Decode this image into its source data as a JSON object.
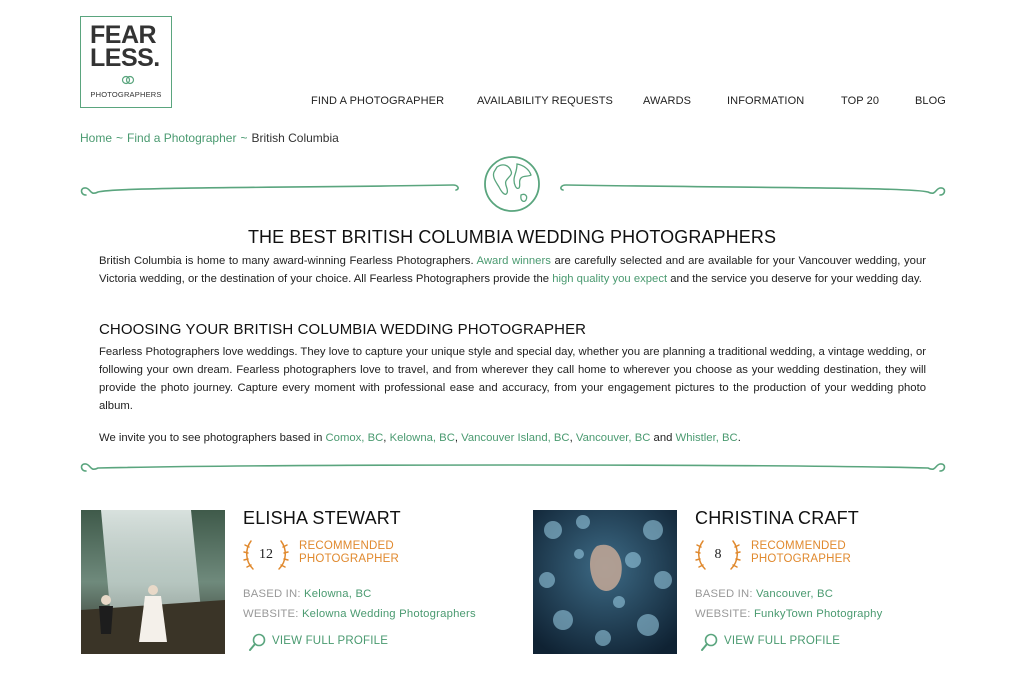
{
  "logo": {
    "line1": "FEAR",
    "line2": "LESS.",
    "sub": "PHOTOGRAPHERS"
  },
  "nav": [
    "FIND A PHOTOGRAPHER",
    "AVAILABILITY REQUESTS",
    "AWARDS",
    "INFORMATION",
    "TOP 20",
    "BLOG"
  ],
  "breadcrumb": {
    "home": "Home",
    "sep": "~",
    "find": "Find a Photographer",
    "current": "British Columbia"
  },
  "title": "THE BEST BRITISH COLUMBIA WEDDING PHOTOGRAPHERS",
  "intro": {
    "t1": "British Columbia is home to many award-winning Fearless Photographers. ",
    "link1": "Award winners",
    "t2": " are carefully selected and are available for your Vancouver wedding, your Victoria wedding, or the destination of your choice. All Fearless Photographers provide the ",
    "link2": "high quality you expect",
    "t3": " and the service you deserve for your wedding day."
  },
  "subtitle": "CHOOSING YOUR BRITISH COLUMBIA WEDDING PHOTOGRAPHER",
  "body": "Fearless Photographers love weddings. They love to capture your unique style and special day, whether you are planning a traditional wedding, a vintage wedding, or following your own dream. Fearless photographers love to travel, and from wherever they call home to wherever you choose as your wedding destination, they will provide the photo journey. Capture every moment with professional ease and accuracy, from your engagement pictures to the production of your wedding photo album.",
  "invite": {
    "t1": "We invite you to see photographers based in ",
    "l1": "Comox, BC",
    "s1": ", ",
    "l2": "Kelowna, BC",
    "s2": ", ",
    "l3": "Vancouver Island, BC",
    "s3": ", ",
    "l4": "Vancouver, BC",
    "s4": " and ",
    "l5": "Whistler, BC",
    "t2": "."
  },
  "cards": [
    {
      "name": "ELISHA STEWART",
      "awards": "12",
      "rec1": "RECOMMENDED",
      "rec2": "PHOTOGRAPHER",
      "based_label": "BASED IN:",
      "based": "Kelowna, BC",
      "website_label": "WEBSITE:",
      "website": "Kelowna Wedding Photographers",
      "profile": "VIEW FULL PROFILE"
    },
    {
      "name": "CHRISTINA CRAFT",
      "awards": "8",
      "rec1": "RECOMMENDED",
      "rec2": "PHOTOGRAPHER",
      "based_label": "BASED IN:",
      "based": "Vancouver, BC",
      "website_label": "WEBSITE:",
      "website": "FunkyTown Photography",
      "profile": "VIEW FULL PROFILE"
    }
  ],
  "colors": {
    "accent": "#4a9a70",
    "orange": "#e0892e",
    "border": "#5aa57e"
  }
}
